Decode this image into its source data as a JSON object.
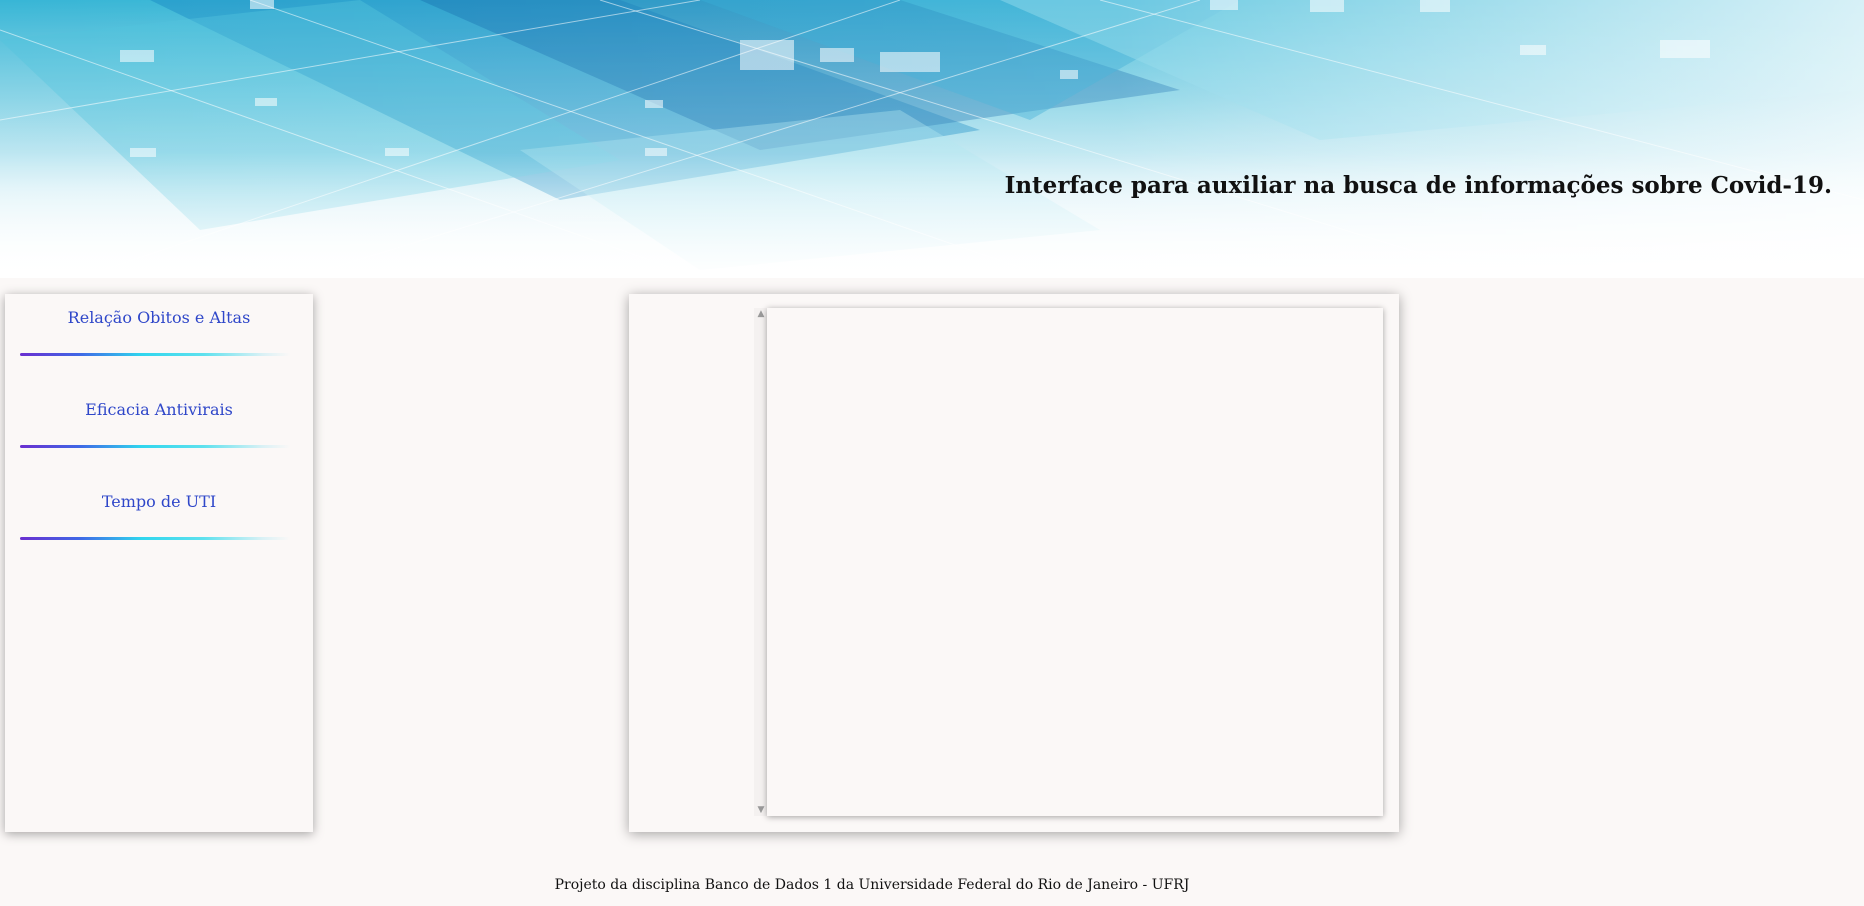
{
  "header": {
    "title": "Interface para auxiliar na busca de informações sobre Covid-19."
  },
  "sidebar": {
    "items": [
      {
        "label": "Relação Obitos e Altas"
      },
      {
        "label": "Eficacia Antivirais"
      },
      {
        "label": "Tempo de UTI"
      }
    ]
  },
  "content": {
    "scroll_up_icon": "▲",
    "scroll_down_icon": "▼"
  },
  "footer": {
    "text": "Projeto da disciplina Banco de Dados 1 da Universidade Federal do Rio de Janeiro - UFRJ"
  },
  "colors": {
    "background": "#fbf8f7",
    "nav_link": "#2f47c9",
    "header_blue": "#38b6d6"
  }
}
